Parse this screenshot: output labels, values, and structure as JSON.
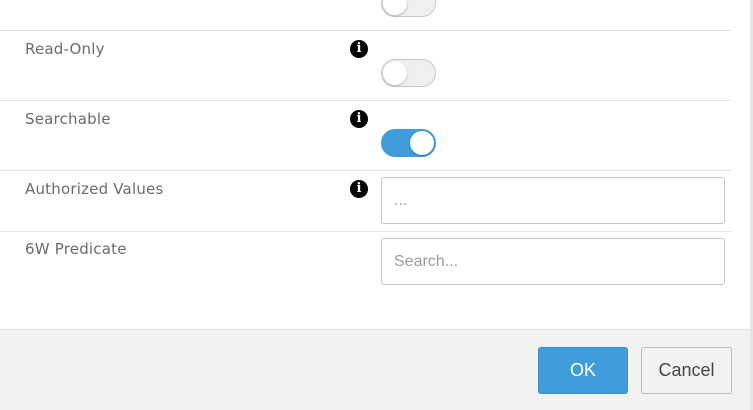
{
  "form": {
    "rows": [
      {
        "label": "",
        "info": false,
        "control": "toggle",
        "state": "off"
      },
      {
        "label": "Read-Only",
        "info": true,
        "control": "toggle",
        "state": "off"
      },
      {
        "label": "Searchable",
        "info": true,
        "control": "toggle",
        "state": "on"
      },
      {
        "label": "Authorized Values",
        "info": true,
        "control": "input",
        "value": "",
        "placeholder": "..."
      },
      {
        "label": "6W Predicate",
        "info": false,
        "control": "input",
        "value": "",
        "placeholder": "Search..."
      }
    ],
    "info_icon_glyph": "i"
  },
  "footer": {
    "ok_label": "OK",
    "cancel_label": "Cancel"
  },
  "colors": {
    "accent": "#3f9ddc",
    "footer_bg": "#f2f2f2",
    "label_text": "#6b6b6b"
  }
}
